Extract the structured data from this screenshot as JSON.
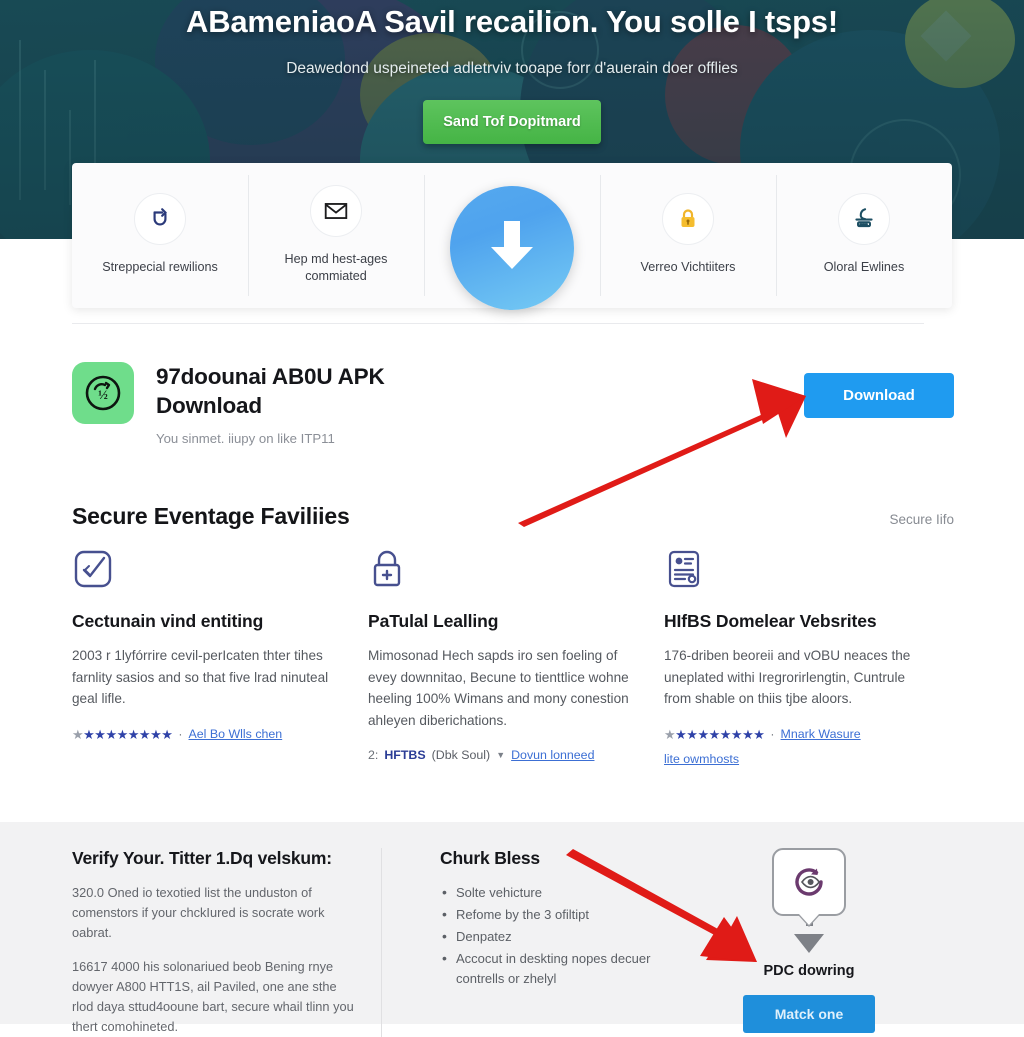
{
  "hero": {
    "title": "ABameniaoA Savil recailion. You solle I tsps!",
    "subtitle": "Deawedond uspeineted adletrviv tooape forr d'auerain doer offlies",
    "cta_label": "Sand Tof Dopitmard",
    "bg_color": "#1d4a54",
    "cta_color": "#4cb94c"
  },
  "feature_strip": {
    "items": [
      {
        "icon": "shield-refresh-icon",
        "label": "Streppecial rewilions"
      },
      {
        "icon": "envelope-icon",
        "label": "Hep md hest-ages commiated"
      },
      {
        "icon": "download-arrow-icon",
        "label": ""
      },
      {
        "icon": "lock-icon",
        "label": "Verreo Vichtiiters"
      },
      {
        "icon": "scanner-icon",
        "label": "Oloral Ewlines"
      }
    ]
  },
  "app_card": {
    "icon": "app-logo-icon",
    "title": "97doounai AB0U APK Download",
    "subtitle": "You sinmet. iiupy on like ITP11",
    "download_label": "Download",
    "download_color": "#1f9bf0",
    "icon_bg": "#6fdd8b"
  },
  "secure_section": {
    "title": "Secure Eventage Faviliies",
    "link": "Secure Iifo",
    "columns": [
      {
        "icon": "verified-check-icon",
        "title": "Cectunain vind entiting",
        "body": "2003 r 1lyfórrire cevil-perIcaten thter tihes farnlity sasios and so that five lrad ninuteal geal lifle.",
        "rating_stars": "★★★★★★★★",
        "rating_dim_star": "★",
        "rating_mark": "·",
        "link": "Ael Bo Wlls chen"
      },
      {
        "icon": "lock-plus-icon",
        "title": "PaTulal Lealling",
        "body": "Mimosonad Hech sapds iro sen foeling of evey downnitao, Becune to tienttlice wohne heeling 100% Wimans and mony conestion ahleyen diberichations.",
        "prefix": "2:",
        "tag": "HFTBS",
        "tag_note": "(Dbk Soul)",
        "link": "Dovun lonneed"
      },
      {
        "icon": "certificate-icon",
        "title": "HIfBS Domelear Vebsrites",
        "body": "176-driben beoreii and vOBU neaces the uneplated withi Iregrorirlengtin, Cuntrule from shable on thiis tjbe aloors.",
        "rating_stars": "★★★★★★★★",
        "rating_dim_star": "★",
        "rating_mark": "·",
        "link": "Mnark Wasure",
        "link2": "lite owmhosts"
      }
    ]
  },
  "bottom": {
    "left": {
      "title": "Verify Your. Titter 1.Dq velskum:",
      "para1": "320.0 Oned io texotied list the unduston of comenstors if your chckIured is socrate work oabrat.",
      "para2": "16617 4000 his solonariued beob Bening rnye dowyer A800 HTT1S, ail Paviled, one ane sthe rlod daya sttud4ooune bart, secure whail tlinn you thert comohineted."
    },
    "middle": {
      "title": "Churk Bless",
      "items": [
        "Solte vehicture",
        "Refome by the 3 ofiltipt",
        "Denpatez",
        "Accocut in deskting nopes decuer contrells or zhelyl"
      ]
    },
    "right": {
      "bubble_icon": "refresh-eye-icon",
      "caption": "PDC dowring",
      "button_label": "Matck one",
      "button_color": "#1f8fdb"
    }
  },
  "annotations": {
    "arrow_color": "#e01b17",
    "arrow1_target": "download-button",
    "arrow2_target": "matck-one-button"
  }
}
